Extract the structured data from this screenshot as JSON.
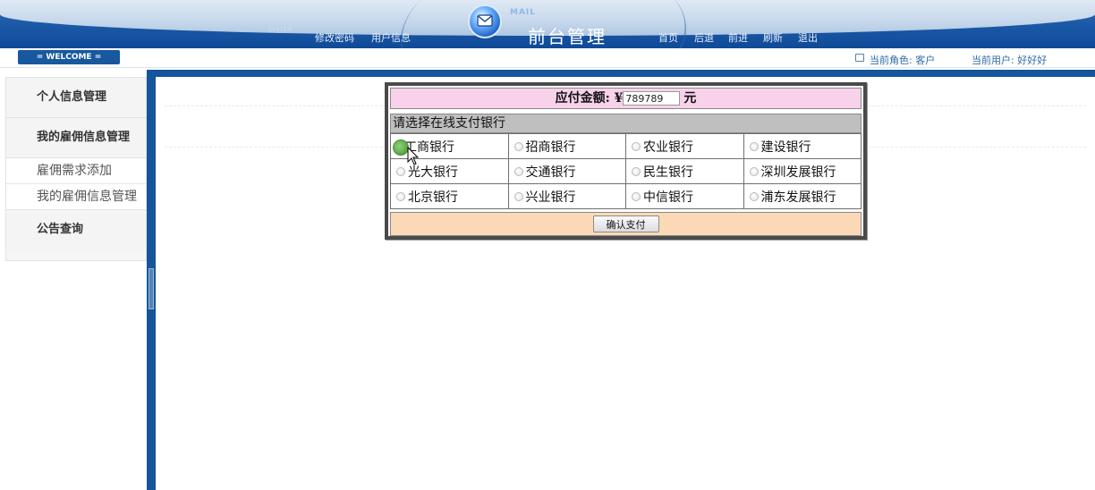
{
  "header": {
    "system_tag": "SYSTEM",
    "links_left": [
      "修改密码",
      "用户信息"
    ],
    "mail_tag": "MAIL",
    "title": "前台管理",
    "links_right": [
      "首页",
      "后退",
      "前进",
      "刷新",
      "退出"
    ]
  },
  "strip": {
    "welcome": "= WELCOME =",
    "role": "当前角色: 客户",
    "user": "当前用户: 好好好"
  },
  "sidebar": {
    "items": [
      {
        "label": "个人信息管理"
      },
      {
        "label": "我的雇佣信息管理"
      },
      {
        "label": "雇佣需求添加"
      },
      {
        "label": "我的雇佣信息管理"
      },
      {
        "label": "公告查询"
      }
    ]
  },
  "payment": {
    "amount_label": "应付金额:",
    "currency_symbol": "¥",
    "amount_value": "789789",
    "amount_unit": "元",
    "prompt": "请选择在线支付银行",
    "banks": [
      [
        "工商银行",
        "招商银行",
        "农业银行",
        "建设银行"
      ],
      [
        "光大银行",
        "交通银行",
        "民生银行",
        "深圳发展银行"
      ],
      [
        "北京银行",
        "兴业银行",
        "中信银行",
        "浦东发展银行"
      ]
    ],
    "selected_bank": "工商银行",
    "submit_label": "确认支付"
  },
  "colors": {
    "header_blue": "#1a58a6",
    "frame_blue": "#14559c",
    "amount_bg": "#f7d2ea",
    "prompt_bg": "#bfbfbf",
    "footer_bg": "#fcd9b6"
  },
  "icons": {
    "mail": "mail-icon",
    "role": "role-icon",
    "cursor": "cursor-icon"
  }
}
